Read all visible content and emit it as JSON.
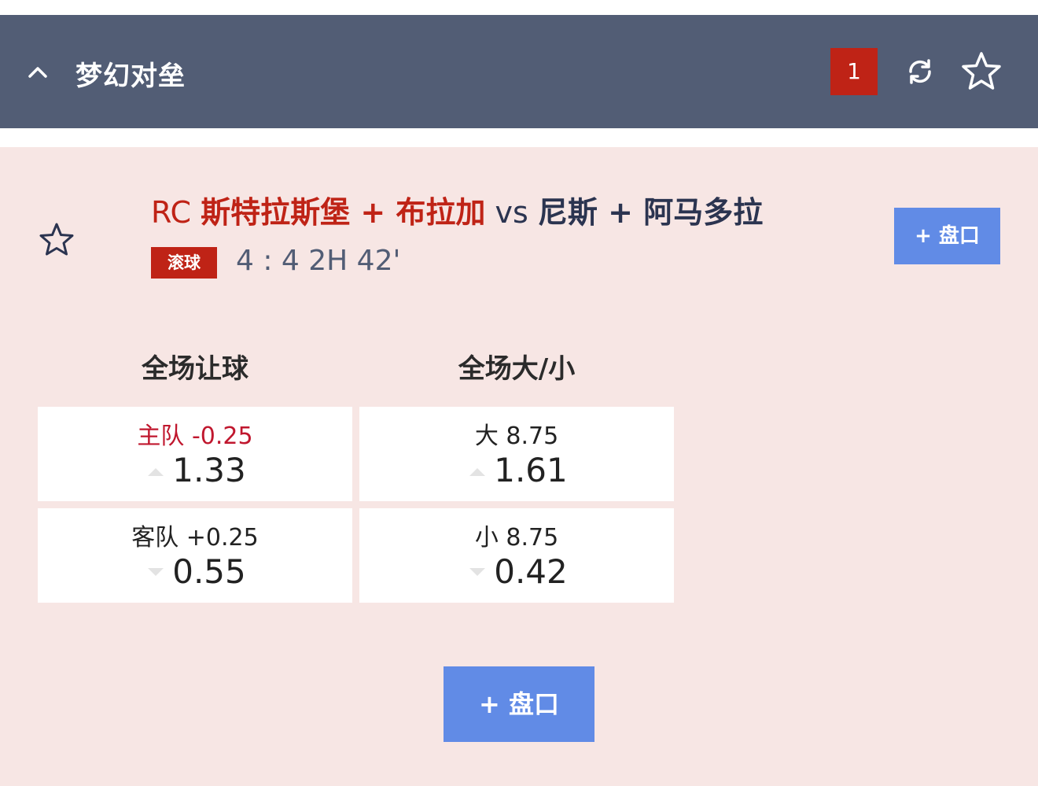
{
  "header": {
    "title": "梦幻对垒",
    "count": "1",
    "collapse_icon": "chevron-up-icon",
    "refresh_icon": "refresh-icon",
    "favorite_icon": "star-outline-icon"
  },
  "match": {
    "home_prefix": "RC ",
    "home_name": "斯特拉斯堡 + 布拉加",
    "vs": " vs ",
    "away_name": "尼斯 + 阿马多拉",
    "live_label": "滚球",
    "score_time": "4 : 4 2H 42'",
    "market_button": "+ 盘口"
  },
  "markets": {
    "handicap_title": "全场让球",
    "totals_title": "全场大/小",
    "handicap": [
      {
        "label": "主队 -0.25",
        "value": "1.33",
        "trend": "up"
      },
      {
        "label": "客队 +0.25",
        "value": "0.55",
        "trend": "down"
      }
    ],
    "totals": [
      {
        "label": "大 8.75",
        "value": "1.61",
        "trend": "up"
      },
      {
        "label": "小 8.75",
        "value": "0.42",
        "trend": "down"
      }
    ]
  },
  "footer": {
    "market_button": "+ 盘口"
  },
  "colors": {
    "header_bg": "#525d75",
    "panel_bg": "#f7e6e4",
    "accent_red": "#bf2316",
    "button_blue": "#618be6"
  }
}
